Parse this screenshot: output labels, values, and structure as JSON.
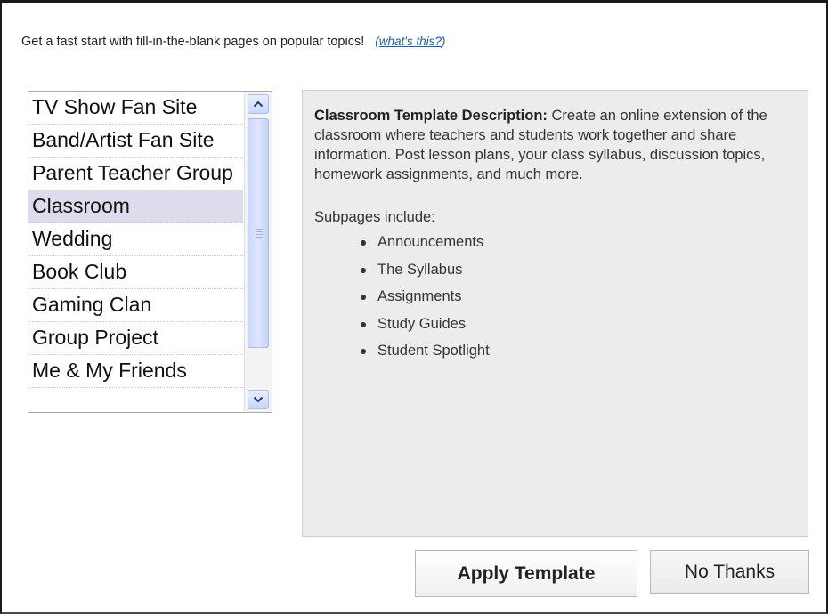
{
  "intro": {
    "text": "Get a fast start with fill-in-the-blank pages on popular topics!",
    "help_link": "what's this?"
  },
  "templates": {
    "items": [
      "TV Show Fan Site",
      "Band/Artist Fan Site",
      "Parent Teacher Group",
      "Classroom",
      "Wedding",
      "Book Club",
      "Gaming Clan",
      "Group Project",
      "Me & My Friends"
    ],
    "selected": "Classroom"
  },
  "description": {
    "heading": "Classroom Template Description:",
    "body": "Create an online extension of the classroom where teachers and students work together and share information. Post lesson plans, your class syllabus, discussion topics, homework assignments, and much more.",
    "subpages_label": "Subpages include:",
    "subpages": [
      "Announcements",
      "The Syllabus",
      "Assignments",
      "Study Guides",
      "Student Spotlight"
    ]
  },
  "buttons": {
    "apply": "Apply Template",
    "cancel": "No Thanks"
  },
  "icons": {
    "scroll_up": "chevron-up-icon",
    "scroll_down": "chevron-down-icon"
  }
}
